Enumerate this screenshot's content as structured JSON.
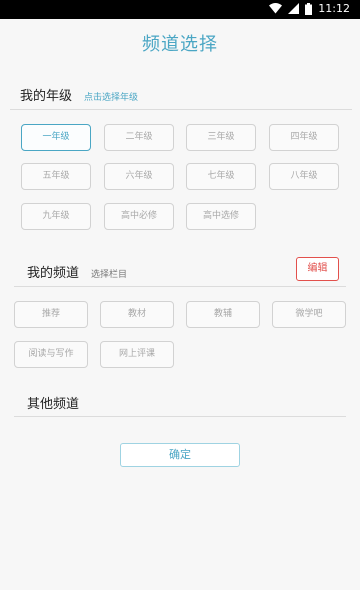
{
  "status_bar": {
    "time": "11:12",
    "icons": [
      "wifi-icon",
      "cell-signal-icon",
      "battery-icon"
    ]
  },
  "page_title": "频道选择",
  "grade_section": {
    "title": "我的年级",
    "hint": "点击选择年级",
    "selected": "一年级",
    "grades": [
      "一年级",
      "二年级",
      "三年级",
      "四年级",
      "五年级",
      "六年级",
      "七年级",
      "八年级",
      "九年级",
      "高中必修",
      "高中选修"
    ]
  },
  "my_channels": {
    "title": "我的频道",
    "hint": "选择栏目",
    "edit_label": "编辑",
    "items": [
      "推荐",
      "教材",
      "教辅",
      "微学吧",
      "阅读与写作",
      "网上评课"
    ]
  },
  "other_channels": {
    "title": "其他频道"
  },
  "confirm_label": "确定",
  "colors": {
    "accent": "#4aa6c4",
    "edit": "#e2504c",
    "chip_border": "#d2d2d2",
    "chip_text": "#a8a8a8",
    "background": "#f7f7f7"
  }
}
